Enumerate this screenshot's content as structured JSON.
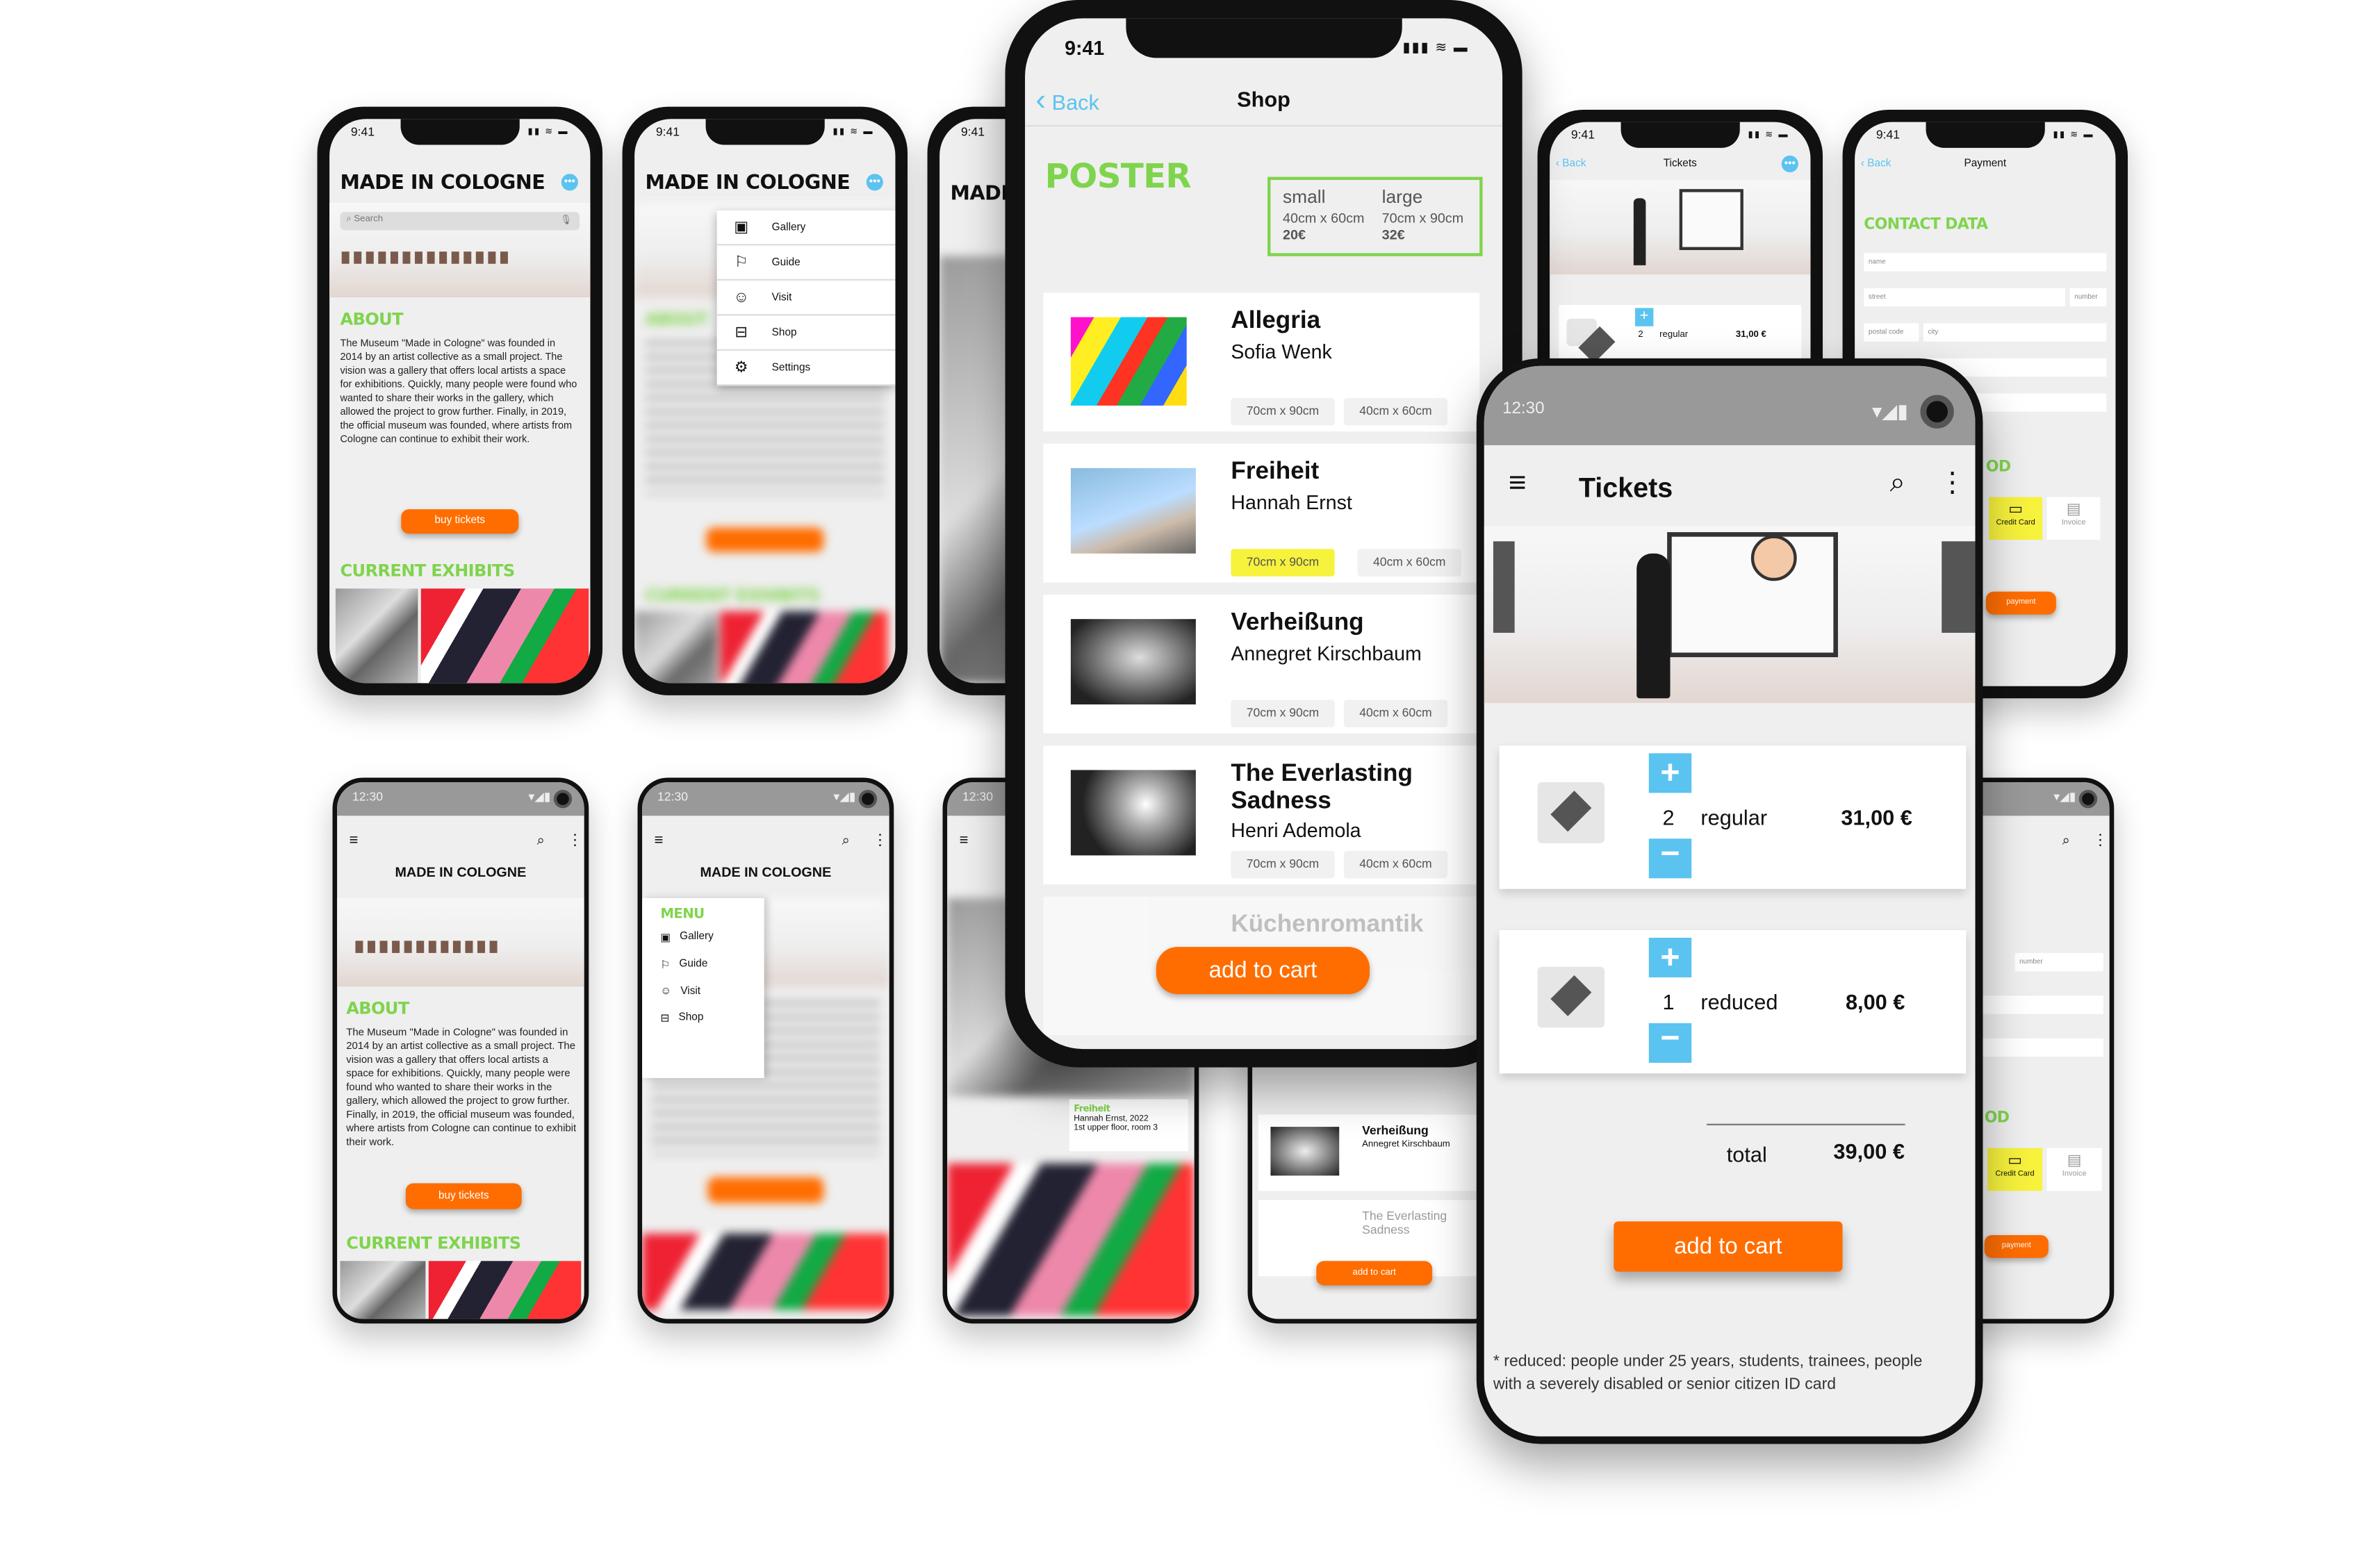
{
  "time_ios": "9:41",
  "time_android": "12:30",
  "brand": "MADE IN COLOGNE",
  "search": "Search",
  "about_title": "ABOUT",
  "about_text": "The Museum \"Made in Cologne\" was founded in 2014 by an artist collective as a small project. The vision was a gallery that offers local artists a space for exhibitions. Quickly, many people were found who wanted to share their works in the gallery, which allowed the project to grow further. Finally, in 2019, the official museum was founded, where artists from Cologne can continue to exhibit their work.",
  "buy_tickets": "buy tickets",
  "current_exhibits": "CURRENT EXHIBITS",
  "menu_title": "MENU",
  "menu": [
    "Gallery",
    "Guide",
    "Visit",
    "Shop",
    "Settings"
  ],
  "menu_icons": [
    "gallery-icon",
    "flag-icon",
    "visit-icon",
    "shop-icon",
    "settings-icon"
  ],
  "shop": {
    "back": "Back",
    "title": "Shop",
    "poster": "POSTER",
    "small_label": "small",
    "small_size": "40cm x 60cm",
    "small_price": "20€",
    "large_label": "large",
    "large_size": "70cm x 90cm",
    "large_price": "32€",
    "items": [
      {
        "title": "Allegria",
        "artist": "Sofia Wenk",
        "size_a": "70cm x 90cm",
        "size_b": "40cm x 60cm"
      },
      {
        "title": "Freiheit",
        "artist": "Hannah Ernst",
        "size_a": "70cm x 90cm",
        "size_b": "40cm x 60cm"
      },
      {
        "title": "Verheißung",
        "artist": "Annegret Kirschbaum",
        "size_a": "70cm x 90cm",
        "size_b": "40cm x 60cm"
      },
      {
        "title": "The Everlasting Sadness",
        "artist": "Henri Ademola",
        "size_a": "70cm x 90cm",
        "size_b": "40cm x 60cm"
      },
      {
        "title": "Küchenromantik"
      }
    ],
    "add_to_cart": "add to cart"
  },
  "tickets": {
    "title": "Tickets",
    "back": "Back",
    "regular_qty": "2",
    "regular_label": "regular",
    "regular_price": "31,00 €",
    "reduced_qty": "1",
    "reduced_label": "reduced",
    "reduced_price": "8,00 €",
    "total_label": "total",
    "total_value": "39,00 €",
    "add_to_cart": "add to cart",
    "footnote": "* reduced: people under 25 years, students, trainees, people with a severely disabled or senior citizen ID card"
  },
  "payment": {
    "back": "Back",
    "title": "Payment",
    "contact": "CONTACT DATA",
    "name": "name",
    "street": "street",
    "number": "number",
    "postal": "postal code",
    "city": "city",
    "method_partial": "OD",
    "credit": "Credit Card",
    "invoice": "Invoice",
    "pay": "payment"
  },
  "mid_bottom": {
    "freiheit": "Freiheit",
    "freiheit_meta1": "Hannah Ernst, 2022",
    "freiheit_meta2": "1st upper floor, room 3",
    "verheissung": "Verheißung",
    "verheissung_artist": "Annegret Kirschbaum",
    "everlasting": "The Everlasting Sadness",
    "add_to_cart": "add to cart"
  },
  "colors": {
    "accent": "#ff6d00",
    "green": "#7fd44d",
    "blue": "#5bc3f0",
    "yellow": "#f7f23c"
  }
}
